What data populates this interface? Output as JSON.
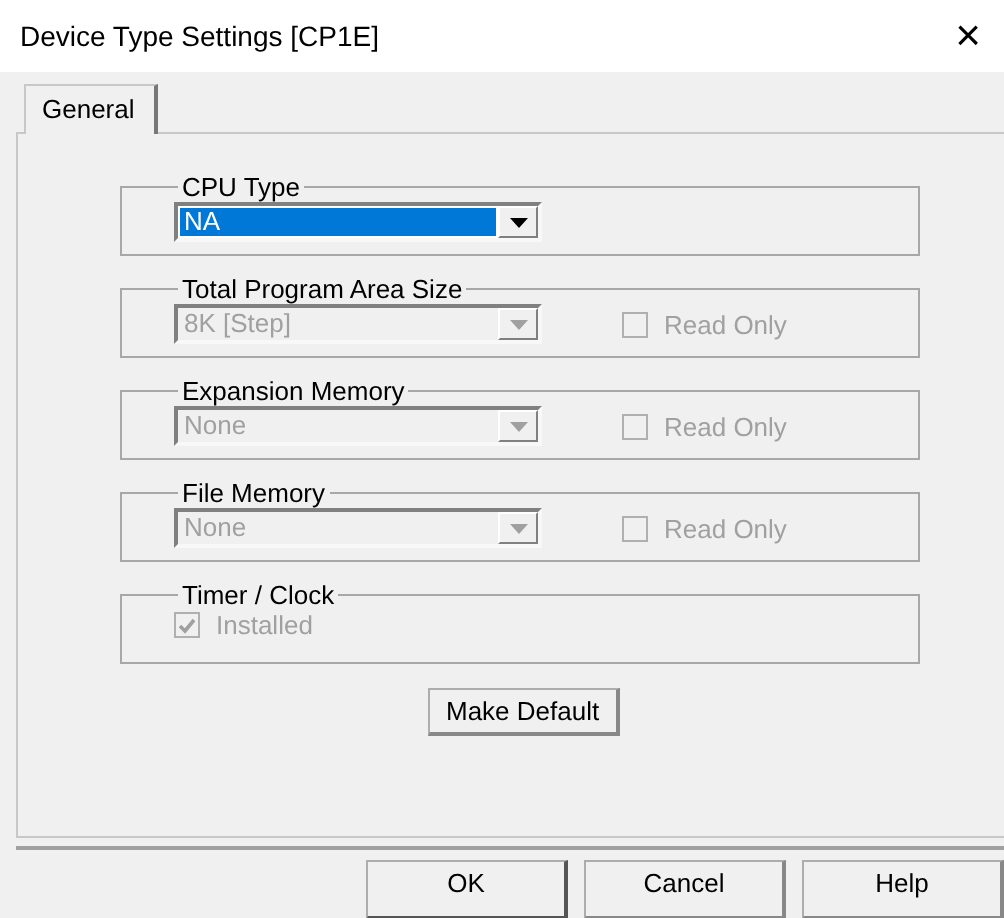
{
  "window": {
    "title": "Device Type Settings [CP1E]",
    "close": "×"
  },
  "tabs": [
    {
      "label": "General",
      "selected": true
    }
  ],
  "groups": [
    {
      "kind": "combo",
      "title": "CPU Type",
      "combo": {
        "value": "NA",
        "disabled": false,
        "selected": true
      }
    },
    {
      "kind": "combo",
      "title": "Total Program Area Size",
      "combo": {
        "value": "8K [Step]",
        "disabled": true,
        "selected": false
      },
      "checkbox": {
        "label": "Read Only",
        "checked": false,
        "disabled": true
      }
    },
    {
      "kind": "combo",
      "title": "Expansion Memory",
      "combo": {
        "value": "None",
        "disabled": true,
        "selected": false
      },
      "checkbox": {
        "label": "Read Only",
        "checked": false,
        "disabled": true
      }
    },
    {
      "kind": "combo",
      "title": "File Memory",
      "combo": {
        "value": "None",
        "disabled": true,
        "selected": false
      },
      "checkbox": {
        "label": "Read Only",
        "checked": false,
        "disabled": true
      }
    },
    {
      "kind": "check",
      "title": "Timer / Clock",
      "checkbox": {
        "label": "Installed",
        "checked": true,
        "disabled": true
      }
    }
  ],
  "make_default": "Make Default",
  "buttons": [
    {
      "label": "OK",
      "default": true
    },
    {
      "label": "Cancel",
      "default": false
    },
    {
      "label": "Help",
      "default": false
    }
  ]
}
